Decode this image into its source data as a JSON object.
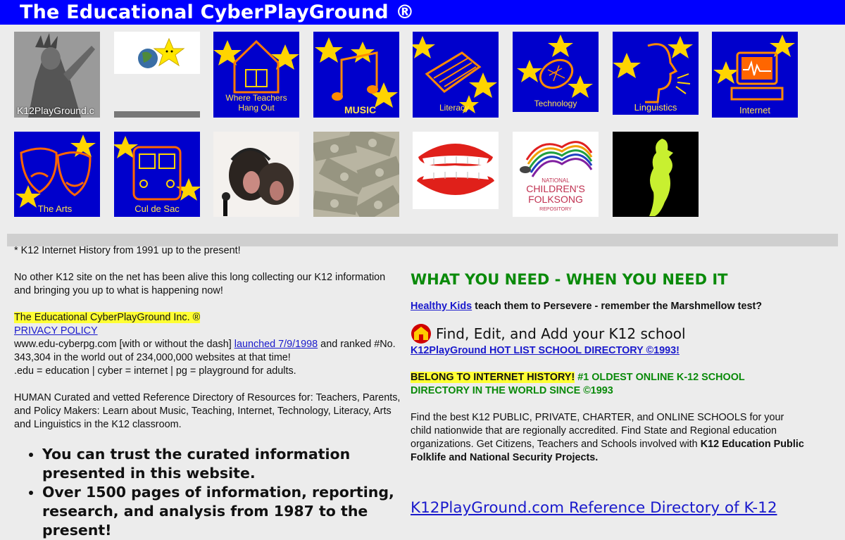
{
  "header": {
    "title": "The Educational CyberPlayGround ®"
  },
  "tiles": {
    "liberty": {
      "label": "K12PlayGround.c",
      "icon": "statue-of-liberty-photo"
    },
    "globe": {
      "icon": "globe-star-icon"
    },
    "teachers": {
      "label_line1": "Where Teachers",
      "label_line2": "Hang Out",
      "icon": "schoolhouse-icon"
    },
    "music": {
      "label": "MUSIC",
      "icon": "music-notes-icon"
    },
    "literacy": {
      "label": "Literacy",
      "icon": "typewriter-icon"
    },
    "technology": {
      "label": "Technology",
      "icon": "satellite-dish-icon"
    },
    "linguistics": {
      "label": "Linguistics",
      "icon": "speaking-head-icon"
    },
    "internet": {
      "label": "Internet",
      "icon": "computer-icon"
    },
    "arts": {
      "label": "The Arts",
      "icon": "theater-masks-icon"
    },
    "culdesac": {
      "label": "Cul de Sac",
      "icon": "school-bus-icon"
    },
    "chimps": {
      "icon": "singing-chimps-photo"
    },
    "money": {
      "icon": "money-pile-photo"
    },
    "teeth": {
      "icon": "chattering-teeth-icon"
    },
    "folksong": {
      "line1": "NATIONAL",
      "line2": "CHILDREN'S",
      "line3": "FOLKSONG",
      "line4": "REPOSITORY",
      "icon": "folksong-logo"
    },
    "silhouette": {
      "icon": "singer-silhouette-icon"
    }
  },
  "left": {
    "history": "* K12 Internet History from 1991 up to the present!",
    "alive": "No other K12 site on the net has been alive this long collecting our K12 information and bringing you up to what is happening now!",
    "company": "The Educational CyberPlayGround Inc. ®",
    "privacy": "PRIVACY POLICY",
    "domain_pre": "www.edu-cyberpg.com [with or without the dash] ",
    "launched": "launched 7/9/1998",
    "domain_post": " and ranked #No. 343,304 in the world out of 234,000,000 websites at that time!",
    "edu_line": ".edu = education | cyber = internet | pg = playground for adults.",
    "human": "HUMAN Curated and vetted Reference Directory of Resources for: Teachers, Parents, and Policy Makers: Learn about Music, Teaching, Internet, Technology, Literacy, Arts and Linguistics in the K12 classroom.",
    "bullets": [
      "You can trust the curated information presented in this website.",
      "Over 1500 pages of information, reporting, research, and analysis from 1987 to the present!"
    ]
  },
  "right": {
    "heading": "WHAT YOU NEED - WHEN YOU NEED IT",
    "healthy_link": "Healthy Kids",
    "healthy_rest": " teach them to Persevere - remember the Marshmellow test?",
    "find": "Find, Edit, and Add your K12 school",
    "hotlist": "K12PlayGround HOT LIST SCHOOL DIRECTORY ©1993!",
    "belong_hl": "BELONG TO INTERNET HISTORY!",
    "belong_green": " #1 OLDEST ONLINE K-12 SCHOOL DIRECTORY IN THE WORLD SINCE ©1993",
    "find_best": "Find the best K12 PUBLIC, PRIVATE, CHARTER, and ONLINE SCHOOLS for your child nationwide that are regionally accredited. Find State and Regional education organizations. Get Citizens, Teachers and Schools involved with ",
    "find_best_bold": "K12 Education Public Folklife and National Security Projects.",
    "refdir": "K12PlayGround.com Reference Directory of K-12"
  }
}
